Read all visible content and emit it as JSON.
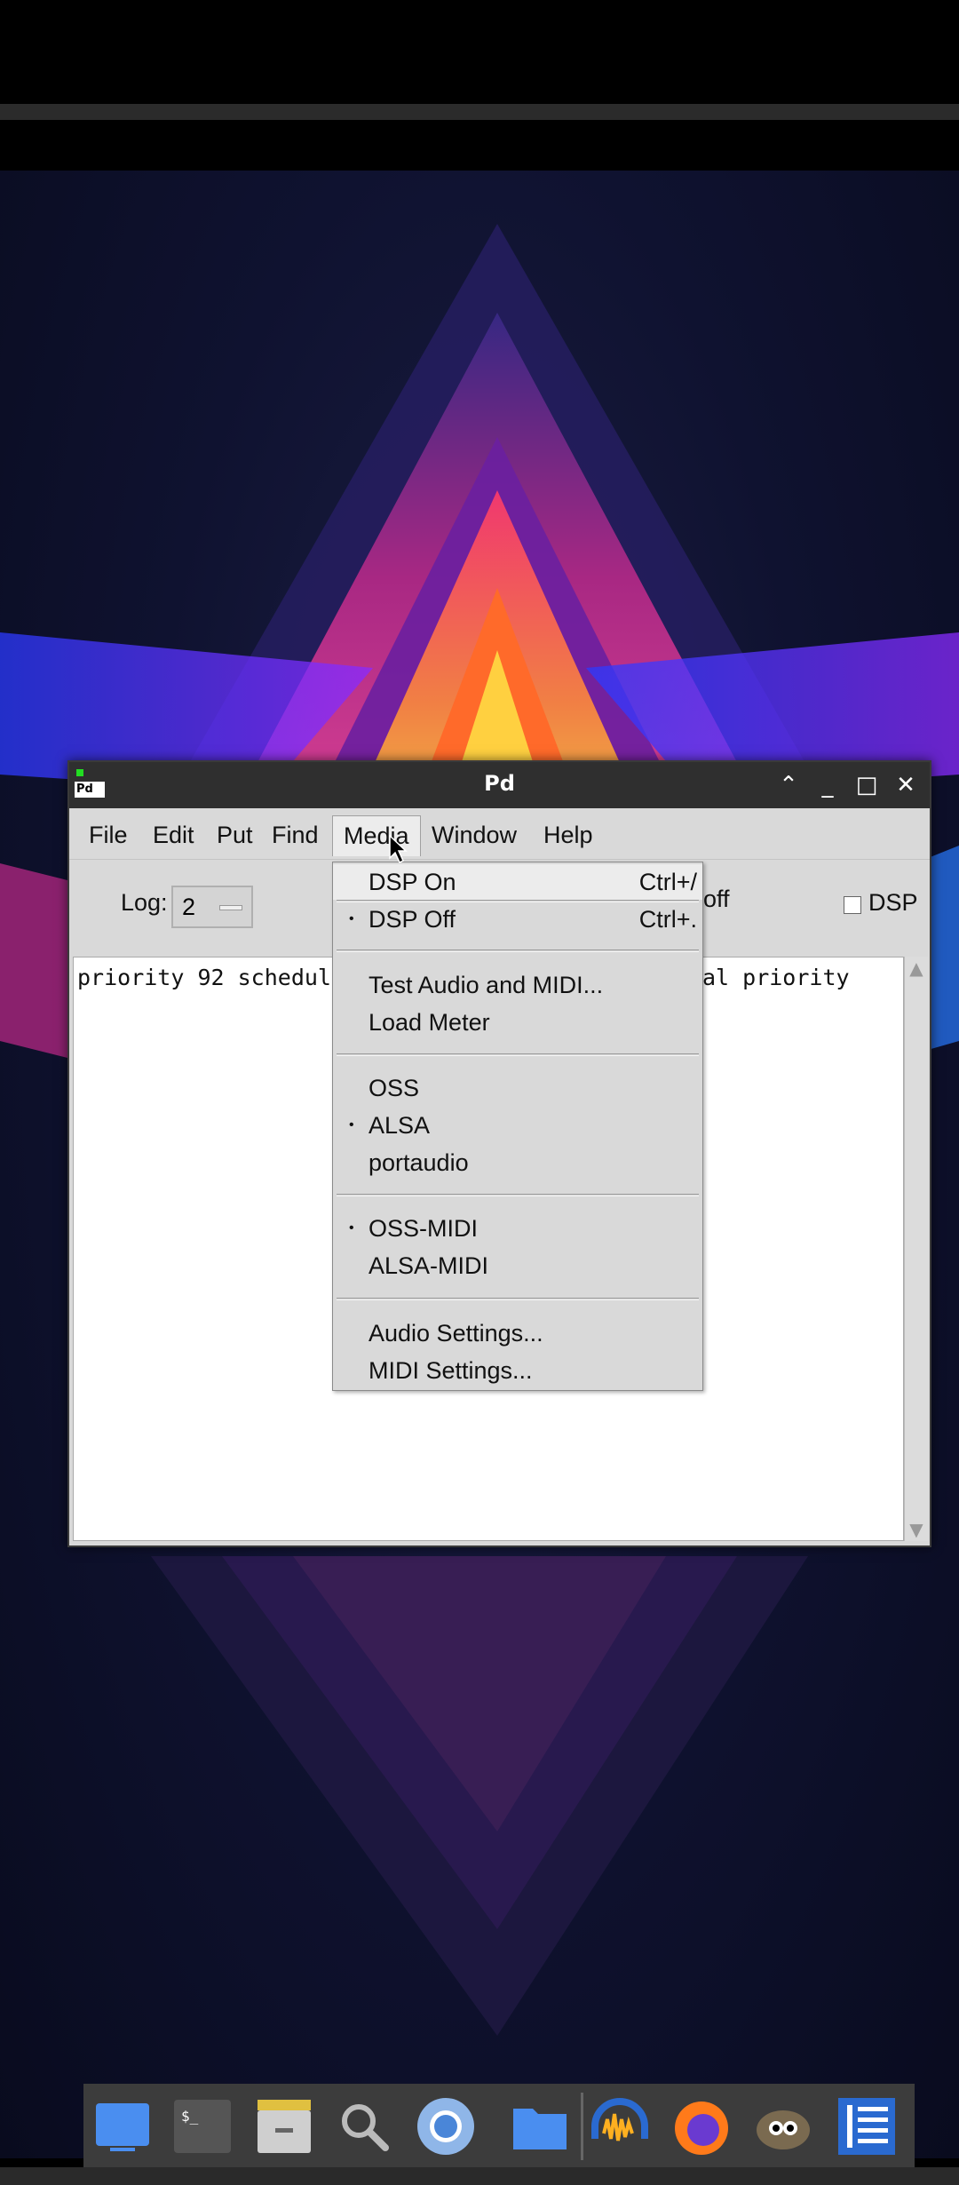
{
  "window": {
    "title": "Pd",
    "app_icon_text": "Pd"
  },
  "menubar": {
    "items": [
      "File",
      "Edit",
      "Put",
      "Find",
      "Media",
      "Window",
      "Help"
    ],
    "active": "Media"
  },
  "toolbar": {
    "log_label": "Log:",
    "log_value": "2",
    "audio_status": "off",
    "dsp_label": "DSP",
    "dsp_checked": false
  },
  "console": {
    "line_left": "priority 92 schedul",
    "line_right": "al priority"
  },
  "media_menu": {
    "items": [
      {
        "label": "DSP On",
        "accel": "Ctrl+/",
        "checked": false,
        "highlighted": true
      },
      {
        "label": "DSP Off",
        "accel": "Ctrl+.",
        "checked": true
      },
      {
        "label": "Test Audio and MIDI...",
        "accel": "",
        "checked": false
      },
      {
        "label": "Load Meter",
        "accel": "",
        "checked": false
      },
      {
        "label": "OSS",
        "accel": "",
        "checked": false
      },
      {
        "label": "ALSA",
        "accel": "",
        "checked": true
      },
      {
        "label": "portaudio",
        "accel": "",
        "checked": false
      },
      {
        "label": "OSS-MIDI",
        "accel": "",
        "checked": true
      },
      {
        "label": "ALSA-MIDI",
        "accel": "",
        "checked": false
      },
      {
        "label": "Audio Settings...",
        "accel": "",
        "checked": false
      },
      {
        "label": "MIDI Settings...",
        "accel": "",
        "checked": false
      }
    ],
    "bullet": "•"
  },
  "dock": {
    "icons": [
      "desktop-icon",
      "terminal-icon",
      "file-archive-icon",
      "search-icon",
      "chromium-icon",
      "files-icon",
      "audacity-icon",
      "firefox-icon",
      "gimp-icon",
      "text-editor-icon"
    ]
  },
  "colors": {
    "titlebar": "#2f2f2f",
    "menu_bg": "#d9d9d9",
    "highlight": "#ececec",
    "dock": "#3c3c3c"
  }
}
